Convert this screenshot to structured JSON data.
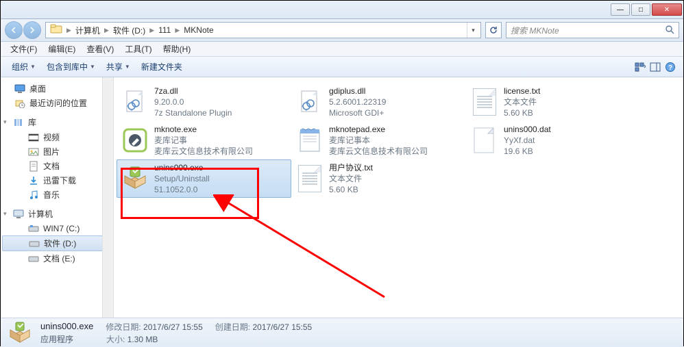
{
  "titlebar": {
    "min": "—",
    "max": "□",
    "close": "✕"
  },
  "address": {
    "crumbs": [
      "计算机",
      "软件 (D:)",
      "111",
      "MKNote"
    ],
    "search_placeholder": "搜索 MKNote"
  },
  "menu": {
    "file": "文件(F)",
    "edit": "编辑(E)",
    "view": "查看(V)",
    "tools": "工具(T)",
    "help": "帮助(H)"
  },
  "toolbar": {
    "organize": "组织",
    "include": "包含到库中",
    "share": "共享",
    "newfolder": "新建文件夹"
  },
  "sidebar": {
    "desktop": "桌面",
    "recent": "最近访问的位置",
    "libraries": "库",
    "videos": "视频",
    "pictures": "图片",
    "documents": "文档",
    "xunlei": "迅雷下载",
    "music": "音乐",
    "computer": "计算机",
    "drive_c": "WIN7 (C:)",
    "drive_d": "软件 (D:)",
    "drive_e": "文档 (E:)"
  },
  "files": [
    {
      "name": "7za.dll",
      "line2": "9.20.0.0",
      "line3": "7z Standalone Plugin",
      "icon": "dll"
    },
    {
      "name": "gdiplus.dll",
      "line2": "5.2.6001.22319",
      "line3": "Microsoft GDI+",
      "icon": "dll"
    },
    {
      "name": "license.txt",
      "line2": "文本文件",
      "line3": "5.60 KB",
      "icon": "txt"
    },
    {
      "name": "mknote.exe",
      "line2": "麦库记事",
      "line3": "麦库云文信息技术有限公司",
      "icon": "mknote"
    },
    {
      "name": "mknotepad.exe",
      "line2": "麦库记事本",
      "line3": "麦库云文信息技术有限公司",
      "icon": "notepad"
    },
    {
      "name": "unins000.dat",
      "line2": "YyXf.dat",
      "line3": "19.6 KB",
      "icon": "blank"
    },
    {
      "name": "unins000.exe",
      "line2": "Setup/Uninstall",
      "line3": "51.1052.0.0",
      "icon": "installer",
      "selected": true
    },
    {
      "name": "用户协议.txt",
      "line2": "文本文件",
      "line3": "5.60 KB",
      "icon": "txt"
    }
  ],
  "status": {
    "name": "unins000.exe",
    "type": "应用程序",
    "mod_label": "修改日期:",
    "mod_val": "2017/6/27 15:55",
    "create_label": "创建日期:",
    "create_val": "2017/6/27 15:55",
    "size_label": "大小:",
    "size_val": "1.30 MB"
  }
}
